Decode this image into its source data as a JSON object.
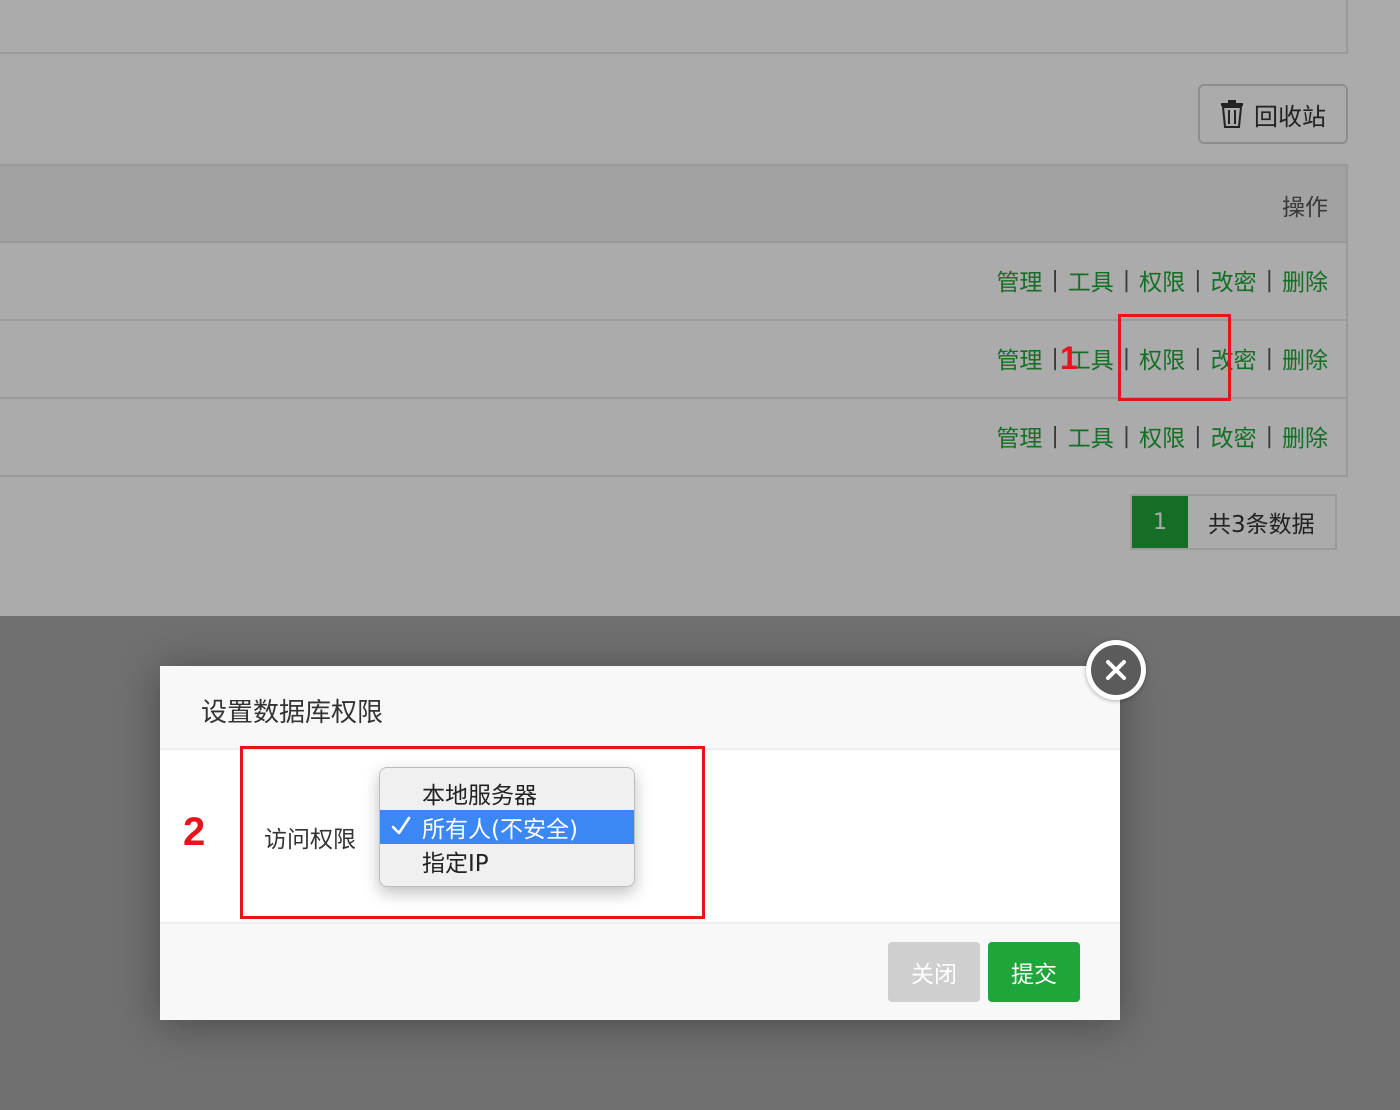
{
  "background": {
    "recycle_bin_label": "回收站",
    "table": {
      "operation_header": "操作",
      "rows": [
        {
          "actions": [
            "管理",
            "工具",
            "权限",
            "改密",
            "删除"
          ]
        },
        {
          "actions": [
            "管理",
            "工具",
            "权限",
            "改密",
            "删除"
          ]
        },
        {
          "actions": [
            "管理",
            "工具",
            "权限",
            "改密",
            "删除"
          ]
        }
      ]
    },
    "pagination": {
      "current_page": "1",
      "total_label": "共3条数据"
    }
  },
  "modal": {
    "title": "设置数据库权限",
    "field_label": "访问权限",
    "dropdown": {
      "options": [
        "本地服务器",
        "所有人(不安全)",
        "指定IP"
      ],
      "selected_option": "所有人(不安全)"
    },
    "close_label": "关闭",
    "submit_label": "提交"
  },
  "annotations": {
    "step1_label": "1",
    "step2_label": "2",
    "color": "#e8131b"
  },
  "colors": {
    "accent_green": "#20a53a",
    "link_green": "#20a53a",
    "selection_blue": "#3c87f6"
  },
  "icons": {
    "recycle_bin": "trash-icon",
    "close": "close-icon",
    "check": "check-icon"
  }
}
